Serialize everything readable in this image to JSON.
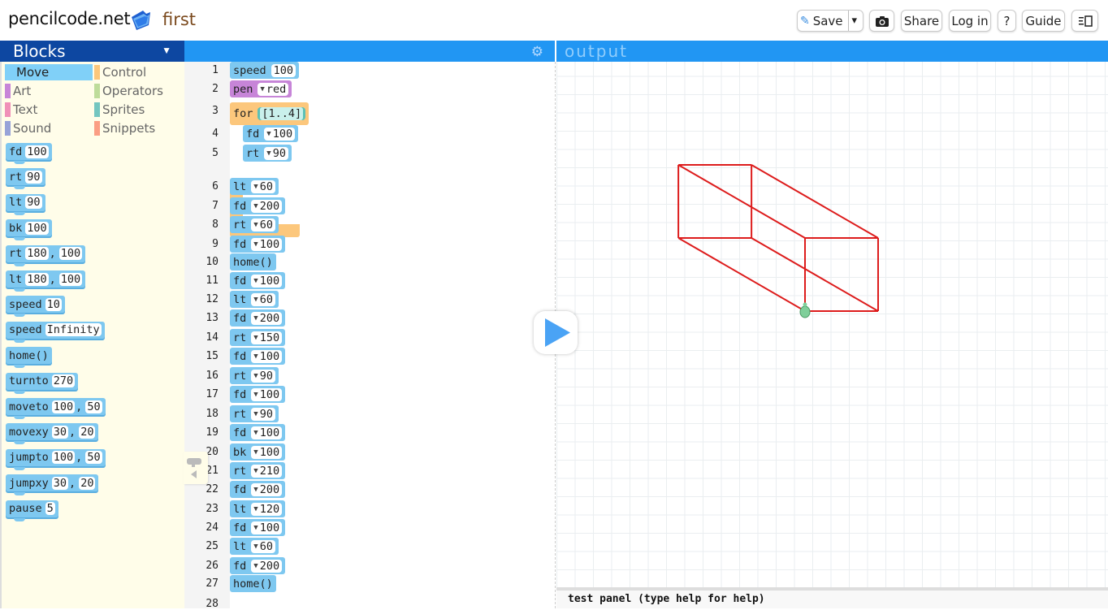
{
  "topbar": {
    "site": "pencilcode.net",
    "filename": "first",
    "buttons": {
      "save": "Save",
      "save_dropdown": "▾",
      "share": "Share",
      "login": "Log in",
      "help": "?",
      "guide": "Guide"
    }
  },
  "blocks_panel": {
    "title": "Blocks",
    "dropdown": "▼",
    "categories": [
      {
        "label": "Move",
        "color": "#80d0f8",
        "selected": true
      },
      {
        "label": "Control",
        "color": "#fcc77c"
      },
      {
        "label": "Art",
        "color": "#c785d8"
      },
      {
        "label": "Operators",
        "color": "#bedc9a"
      },
      {
        "label": "Text",
        "color": "#f090b8"
      },
      {
        "label": "Sprites",
        "color": "#74c6c0"
      },
      {
        "label": "Sound",
        "color": "#97a3d8"
      },
      {
        "label": "Snippets",
        "color": "#fb9e84"
      }
    ],
    "blocks": [
      {
        "cmd": "fd",
        "args": [
          "100"
        ]
      },
      {
        "cmd": "rt",
        "args": [
          "90"
        ]
      },
      {
        "cmd": "lt",
        "args": [
          "90"
        ]
      },
      {
        "cmd": "bk",
        "args": [
          "100"
        ]
      },
      {
        "cmd": "rt",
        "args": [
          "180",
          "100"
        ]
      },
      {
        "cmd": "lt",
        "args": [
          "180",
          "100"
        ]
      },
      {
        "cmd": "speed",
        "args": [
          "10"
        ]
      },
      {
        "cmd": "speed",
        "args": [
          "Infinity"
        ]
      },
      {
        "cmd": "home()",
        "args": []
      },
      {
        "cmd": "turnto",
        "args": [
          "270"
        ]
      },
      {
        "cmd": "moveto",
        "args": [
          "100",
          "50"
        ]
      },
      {
        "cmd": "movexy",
        "args": [
          "30",
          "20"
        ]
      },
      {
        "cmd": "jumpto",
        "args": [
          "100",
          "50"
        ]
      },
      {
        "cmd": "jumpxy",
        "args": [
          "30",
          "20"
        ]
      },
      {
        "cmd": "pause",
        "args": [
          "5"
        ]
      }
    ]
  },
  "editor": {
    "line_numbers": [
      "1",
      "2",
      "3",
      "4",
      "5",
      "6",
      "7",
      "8",
      "9",
      "10",
      "11",
      "12",
      "13",
      "14",
      "15",
      "16",
      "17",
      "18",
      "19",
      "20",
      "21",
      "22",
      "23",
      "24",
      "25",
      "26",
      "27",
      "28"
    ],
    "program": [
      {
        "cmd": "speed",
        "arg": "100",
        "kind": "move",
        "dropdown": false
      },
      {
        "cmd": "pen",
        "arg": "red",
        "kind": "art",
        "dropdown": true
      },
      {
        "cmd": "for",
        "arg": "[1..4]",
        "kind": "control",
        "dropdown": false
      },
      {
        "cmd": "fd",
        "arg": "100",
        "kind": "move",
        "dropdown": true,
        "indent": true
      },
      {
        "cmd": "rt",
        "arg": "90",
        "kind": "move",
        "dropdown": true,
        "indent": true
      },
      {
        "cmd": "lt",
        "arg": "60",
        "kind": "move",
        "dropdown": true
      },
      {
        "cmd": "fd",
        "arg": "200",
        "kind": "move",
        "dropdown": true
      },
      {
        "cmd": "rt",
        "arg": "60",
        "kind": "move",
        "dropdown": true
      },
      {
        "cmd": "fd",
        "arg": "100",
        "kind": "move",
        "dropdown": true
      },
      {
        "cmd": "home()",
        "arg": null,
        "kind": "move"
      },
      {
        "cmd": "fd",
        "arg": "100",
        "kind": "move",
        "dropdown": true
      },
      {
        "cmd": "lt",
        "arg": "60",
        "kind": "move",
        "dropdown": true
      },
      {
        "cmd": "fd",
        "arg": "200",
        "kind": "move",
        "dropdown": true
      },
      {
        "cmd": "rt",
        "arg": "150",
        "kind": "move",
        "dropdown": true
      },
      {
        "cmd": "fd",
        "arg": "100",
        "kind": "move",
        "dropdown": true
      },
      {
        "cmd": "rt",
        "arg": "90",
        "kind": "move",
        "dropdown": true
      },
      {
        "cmd": "fd",
        "arg": "100",
        "kind": "move",
        "dropdown": true
      },
      {
        "cmd": "rt",
        "arg": "90",
        "kind": "move",
        "dropdown": true
      },
      {
        "cmd": "fd",
        "arg": "100",
        "kind": "move",
        "dropdown": true
      },
      {
        "cmd": "bk",
        "arg": "100",
        "kind": "move",
        "dropdown": true
      },
      {
        "cmd": "rt",
        "arg": "210",
        "kind": "move",
        "dropdown": true
      },
      {
        "cmd": "fd",
        "arg": "200",
        "kind": "move",
        "dropdown": true
      },
      {
        "cmd": "lt",
        "arg": "120",
        "kind": "move",
        "dropdown": true
      },
      {
        "cmd": "fd",
        "arg": "100",
        "kind": "move",
        "dropdown": true
      },
      {
        "cmd": "lt",
        "arg": "60",
        "kind": "move",
        "dropdown": true
      },
      {
        "cmd": "fd",
        "arg": "200",
        "kind": "move",
        "dropdown": true
      },
      {
        "cmd": "home()",
        "arg": null,
        "kind": "move"
      }
    ]
  },
  "output": {
    "title": "output",
    "pen_color": "#dd1c1c",
    "test_panel": "test panel (type help for help)"
  }
}
